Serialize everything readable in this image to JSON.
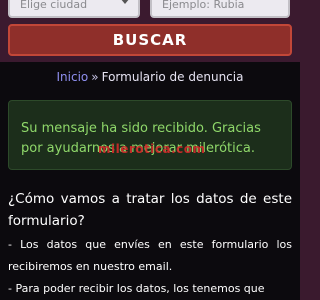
{
  "search": {
    "city_placeholder": "Elige ciudad",
    "query_placeholder": "Ejemplo: Rubia",
    "button_label": "BUSCAR"
  },
  "breadcrumb": {
    "home": "Inicio",
    "separator": "»",
    "current": "Formulario de denuncia"
  },
  "alert": {
    "message": "Su mensaje ha sido recibido. Gracias por ayudarnos a mejorar milerótica.",
    "stamp": "milerotica.com"
  },
  "privacy": {
    "title": "¿Cómo vamos a tratar los datos de este formulario?",
    "lines": [
      "- Los datos que envíes en este formulario los recibiremos en nuestro email.",
      "- Para poder recibir los datos, los tenemos que"
    ]
  },
  "colors": {
    "header_bg": "#3b1a2f",
    "button_bg": "#8f2f2a",
    "alert_text": "#8fd86a",
    "link": "#8f8ff0"
  }
}
